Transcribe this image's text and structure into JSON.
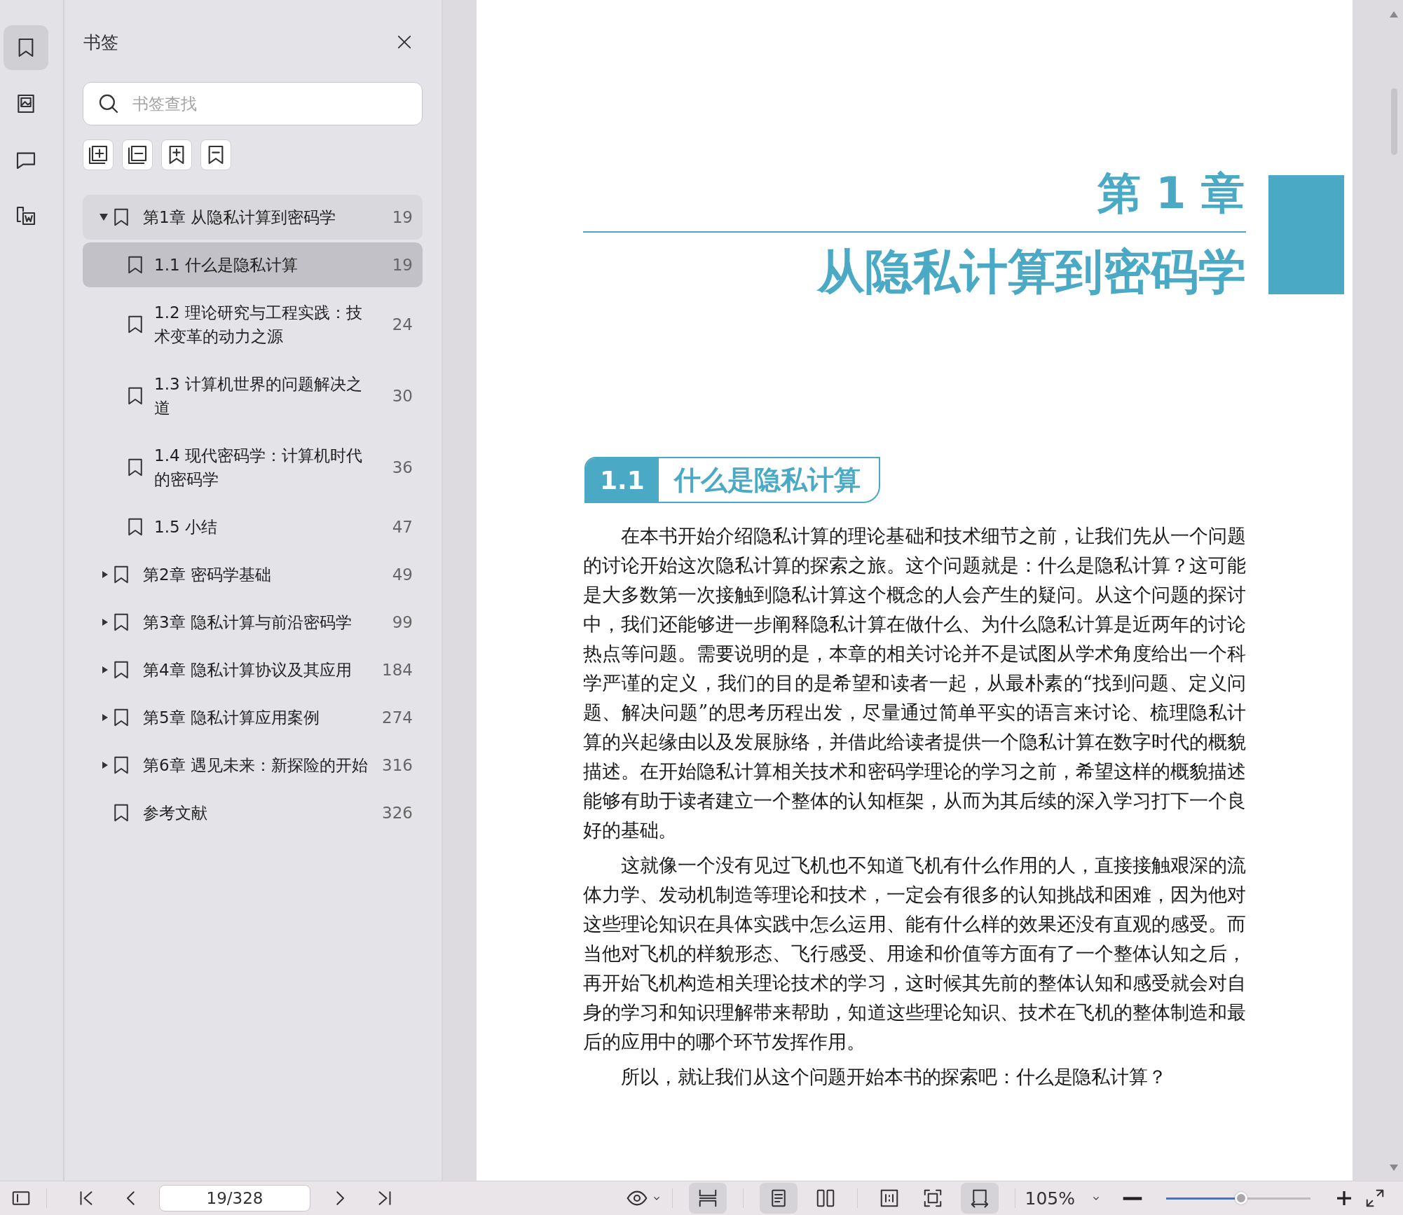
{
  "rail": [
    {
      "kind": "bookmark",
      "selected": true
    },
    {
      "kind": "image",
      "selected": false
    },
    {
      "kind": "comment",
      "selected": false
    },
    {
      "kind": "convert",
      "selected": false
    }
  ],
  "panel": {
    "title": "书签",
    "search": {
      "placeholder": "书签查找"
    },
    "tools": [
      {
        "kind": "expand-all"
      },
      {
        "kind": "collapse-all"
      },
      {
        "kind": "add-bookmark"
      },
      {
        "kind": "remove-bookmark"
      }
    ]
  },
  "bookmarks": [
    {
      "label": "第1章 从隐私计算到密码学",
      "page": "19",
      "expanded": true,
      "selected": false,
      "children": [
        {
          "label": "1.1 什么是隐私计算",
          "page": "19",
          "selected": true
        },
        {
          "label": "1.2 理论研究与工程实践：技术变革的动力之源",
          "page": "24",
          "selected": false
        },
        {
          "label": "1.3 计算机世界的问题解决之道",
          "page": "30",
          "selected": false
        },
        {
          "label": "1.4 现代密码学：计算机时代的密码学",
          "page": "36",
          "selected": false
        },
        {
          "label": "1.5 小结",
          "page": "47",
          "selected": false
        }
      ]
    },
    {
      "label": "第2章 密码学基础",
      "page": "49",
      "expanded": false,
      "selected": false
    },
    {
      "label": "第3章 隐私计算与前沿密码学",
      "page": "99",
      "expanded": false,
      "selected": false
    },
    {
      "label": "第4章 隐私计算协议及其应用",
      "page": "184",
      "expanded": false,
      "selected": false
    },
    {
      "label": "第5章 隐私计算应用案例",
      "page": "274",
      "expanded": false,
      "selected": false
    },
    {
      "label": "第6章 遇见未来：新探险的开始",
      "page": "316",
      "expanded": false,
      "selected": false
    },
    {
      "label": "参考文献",
      "page": "326",
      "selected": false
    }
  ],
  "document": {
    "chapter_label": "第 1 章",
    "chapter_title": "从隐私计算到密码学",
    "section_number": "1.1",
    "section_title": "什么是隐私计算",
    "paragraphs": [
      "在本书开始介绍隐私计算的理论基础和技术细节之前，让我们先从一个问题的讨论开始这次隐私计算的探索之旅。这个问题就是：什么是隐私计算？这可能是大多数第一次接触到隐私计算这个概念的人会产生的疑问。从这个问题的探讨中，我们还能够进一步阐释隐私计算在做什么、为什么隐私计算是近两年的讨论热点等问题。需要说明的是，本章的相关讨论并不是试图从学术角度给出一个科学严谨的定义，我们的目的是希望和读者一起，从最朴素的“找到问题、定义问题、解决问题”的思考历程出发，尽量通过简单平实的语言来讨论、梳理隐私计算的兴起缘由以及发展脉络，并借此给读者提供一个隐私计算在数字时代的概貌描述。在开始隐私计算相关技术和密码学理论的学习之前，希望这样的概貌描述能够有助于读者建立一个整体的认知框架，从而为其后续的深入学习打下一个良好的基础。",
      "这就像一个没有见过飞机也不知道飞机有什么作用的人，直接接触艰深的流体力学、发动机制造等理论和技术，一定会有很多的认知挑战和困难，因为他对这些理论知识在具体实践中怎么运用、能有什么样的效果还没有直观的感受。而当他对飞机的样貌形态、飞行感受、用途和价值等方面有了一个整体认知之后，再开始飞机构造相关理论技术的学习，这时候其先前的整体认知和感受就会对自身的学习和知识理解带来帮助，知道这些理论知识、技术在飞机的整体制造和最后的应用中的哪个环节发挥作用。",
      "所以，就让我们从这个问题开始本书的探索吧：什么是隐私计算？"
    ]
  },
  "bottom_bar": {
    "page_field": "19/328",
    "zoom": "105%",
    "zoom_slider": {
      "level": 0.52
    },
    "view_tools": [
      {
        "kind": "fit-height",
        "selected": true
      },
      {
        "kind": "single-page",
        "selected": true
      },
      {
        "kind": "two-page",
        "selected": false
      },
      {
        "kind": "actual-size",
        "selected": false
      },
      {
        "kind": "fit-page",
        "selected": false
      },
      {
        "kind": "fit-width",
        "selected": true
      }
    ]
  }
}
